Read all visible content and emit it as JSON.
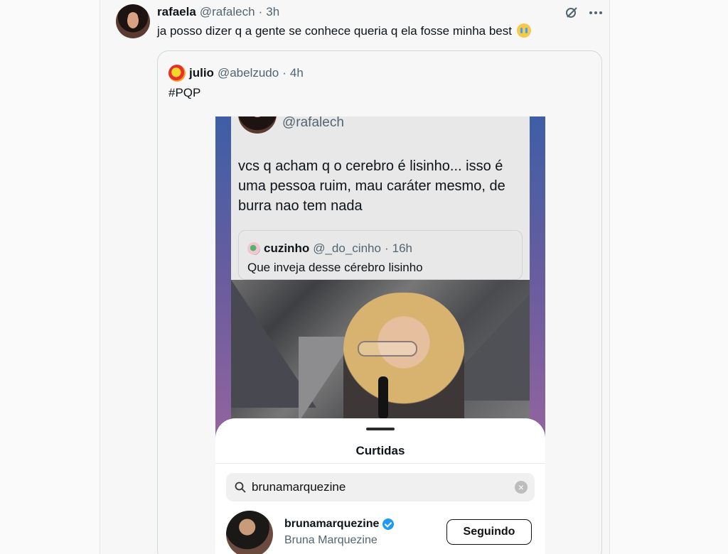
{
  "tweet": {
    "author_name": "rafaela",
    "handle": "@rafalech",
    "separator": "·",
    "time": "3h",
    "text": "ja posso dizer q a gente se conhece queria q ela fosse minha best",
    "emoji_icon": "crying-face-icon"
  },
  "quote": {
    "author_name": "julio",
    "handle": "@abelzudo",
    "separator": "·",
    "time": "4h",
    "text": "#PQP"
  },
  "embedded_screenshot": {
    "inner_handle": "@rafalech",
    "inner_text": "vcs q acham q o cerebro é lisinho... isso é uma pessoa ruim, mau caráter mesmo, de burra nao tem nada",
    "inner_quote": {
      "author_name": "cuzinho",
      "handle": "@_do_cinho",
      "separator": "·",
      "time": "16h",
      "text": "Que inveja desse cérebro lisinho"
    },
    "sheet": {
      "title": "Curtidas",
      "search_value": "brunamarquezine",
      "user": {
        "username": "brunamarquezine",
        "display_name": "Bruna Marquezine",
        "button_label": "Seguindo"
      }
    }
  },
  "colors": {
    "link_blue": "#1d9bf0",
    "muted_text": "#536471",
    "background": "#f7f7f7"
  }
}
